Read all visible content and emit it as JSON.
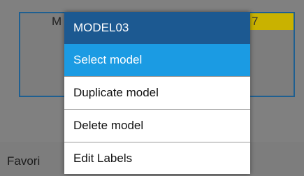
{
  "background": {
    "model_card_title": "M",
    "model_card_badge": "7",
    "favorites_label": "Favori"
  },
  "menu": {
    "title": "MODEL03",
    "items": [
      {
        "label": "Select model",
        "selected": true
      },
      {
        "label": "Duplicate model",
        "selected": false
      },
      {
        "label": "Delete model",
        "selected": false
      },
      {
        "label": "Edit Labels",
        "selected": false
      }
    ]
  },
  "colors": {
    "header_bg": "#1c5991",
    "selected_bg": "#1b9be3",
    "card_border": "#1e5f91",
    "badge_bg": "#c9b200"
  }
}
